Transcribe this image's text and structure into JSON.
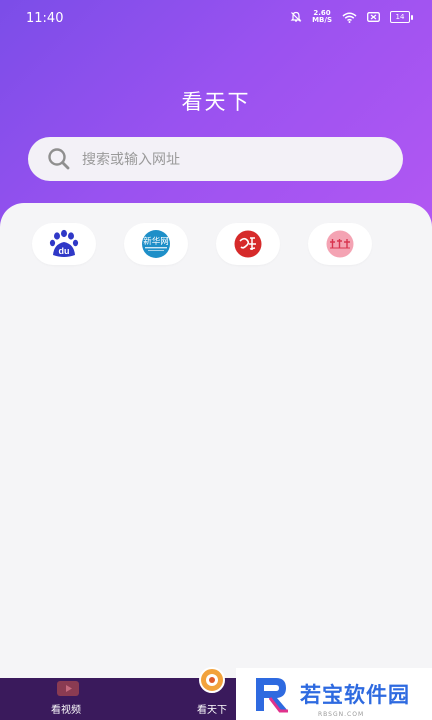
{
  "status_bar": {
    "time": "11:40",
    "net_speed_value": "2.60",
    "net_speed_unit": "MB/S",
    "battery": "14"
  },
  "header": {
    "title": "看天下"
  },
  "search": {
    "placeholder": "搜索或输入网址"
  },
  "shortcuts": [
    {
      "name": "baidu",
      "icon": "baidu-paw-icon",
      "text": "du",
      "color": "#2f38c7"
    },
    {
      "name": "xinhua",
      "icon": "xinhuanet-logo",
      "text": "新华网",
      "color": "#1e8fc8"
    },
    {
      "name": "xuexi",
      "icon": "xuexi-seal-logo",
      "color": "#d62a2a"
    },
    {
      "name": "pink-site",
      "icon": "pink-site-logo",
      "color": "#e8576e"
    }
  ],
  "tab_bar": {
    "tabs": [
      {
        "label": "看视频",
        "icon": "video-icon"
      },
      {
        "label": "看天下",
        "icon": "news-icon",
        "active": true
      }
    ]
  },
  "watermark": {
    "text": "若宝软件园",
    "sub": "RBSGN.COM",
    "accent": "#2e6ae0"
  }
}
